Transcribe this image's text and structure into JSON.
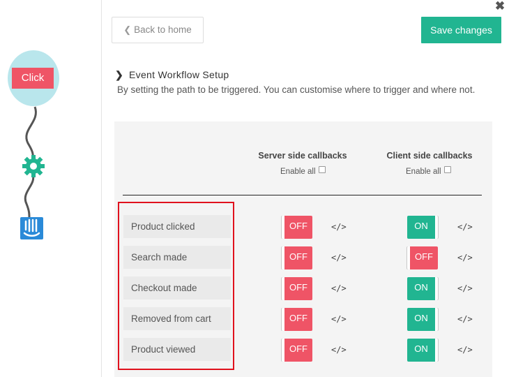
{
  "workflow": {
    "click_node": "Click",
    "node_color": "#ef5466",
    "gear_color": "#21b591",
    "bottom_node_color": "#2a8ad8"
  },
  "header": {
    "back_label": "Back to home",
    "save_label": "Save changes",
    "close_icon": "close-icon"
  },
  "section": {
    "title": "Event Workflow Setup",
    "description": "By setting the path to be triggered. You can customise where to trigger and where not."
  },
  "columns": {
    "server": {
      "title": "Server side callbacks",
      "enable_all": "Enable all"
    },
    "client": {
      "title": "Client side callbacks",
      "enable_all": "Enable all"
    }
  },
  "events": [
    {
      "label": "Product clicked",
      "server": "OFF",
      "client": "ON"
    },
    {
      "label": "Search made",
      "server": "OFF",
      "client": "OFF"
    },
    {
      "label": "Checkout made",
      "server": "OFF",
      "client": "ON"
    },
    {
      "label": "Removed from cart",
      "server": "OFF",
      "client": "ON"
    },
    {
      "label": "Product viewed",
      "server": "OFF",
      "client": "ON"
    }
  ],
  "code_icon_glyph": "</>",
  "colors": {
    "accent": "#21b591",
    "off": "#ef5466",
    "highlight": "#e0111d"
  }
}
